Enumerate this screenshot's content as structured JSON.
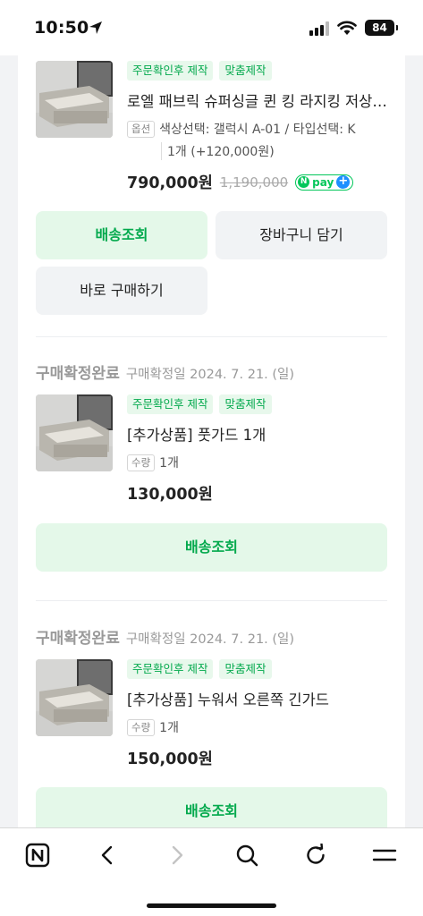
{
  "status_bar": {
    "time": "10:50",
    "battery": "84"
  },
  "items": [
    {
      "tags": [
        "주문확인후 제작",
        "맞춤제작"
      ],
      "name": "로엘 패브릭 슈퍼싱글 퀸 킹 라지킹 저상형 소파베드",
      "option_label": "옵션",
      "option_value": "색상선택: 갤럭시 A-01 / 타입선택: K",
      "option_line2": "1개 (+120,000원)",
      "price": "790,000원",
      "original_price": "1,190,000",
      "npay_text": "pay"
    },
    {
      "status": "구매확정완료",
      "date": "구매확정일 2024. 7. 21. (일)",
      "tags": [
        "주문확인후 제작",
        "맞춤제작"
      ],
      "name": "[추가상품] 풋가드 1개",
      "option_label": "수량",
      "option_value": "1개",
      "price": "130,000원"
    },
    {
      "status": "구매확정완료",
      "date": "구매확정일 2024. 7. 21. (일)",
      "tags": [
        "주문확인후 제작",
        "맞춤제작"
      ],
      "name": "[추가상품] 누워서 오른쪽 긴가드",
      "option_label": "수량",
      "option_value": "1개",
      "price": "150,000원"
    }
  ],
  "buttons": {
    "track": "배송조회",
    "cart": "장바구니 담기",
    "buy_now": "바로 구매하기"
  },
  "bottom_nav": [
    "naver-home-icon",
    "back-arrow-icon",
    "forward-arrow-icon",
    "search-icon",
    "refresh-icon",
    "menu-icon"
  ]
}
